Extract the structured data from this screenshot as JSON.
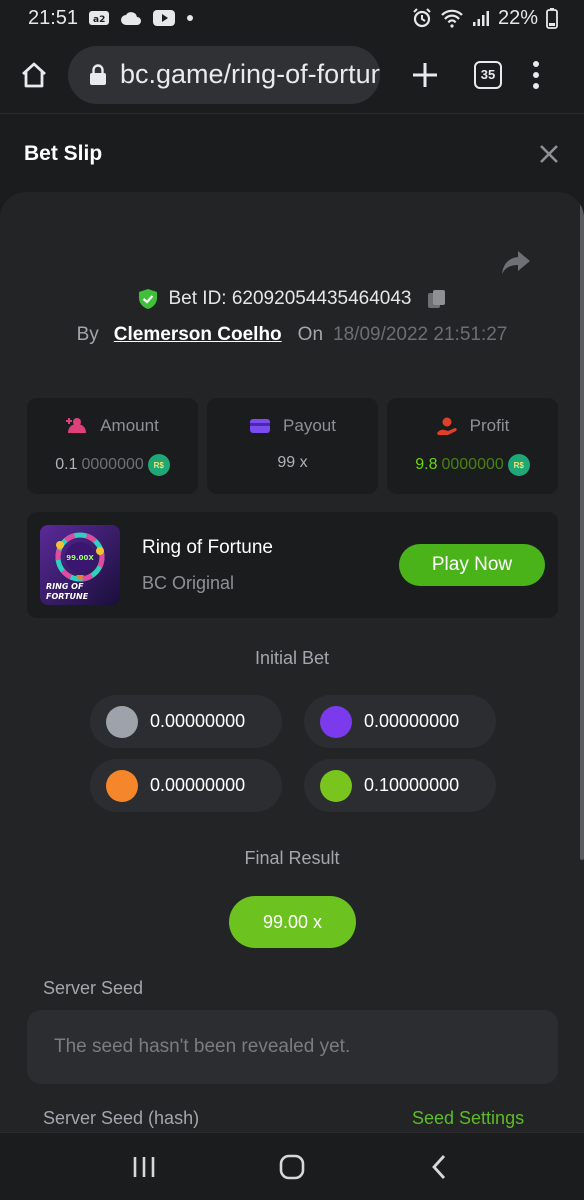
{
  "status_bar": {
    "time": "21:51",
    "battery": "22%"
  },
  "browser": {
    "url": "bc.game/ring-of-fortune",
    "tab_count": "35"
  },
  "modal": {
    "title": "Bet Slip"
  },
  "bet": {
    "id_label": "Bet ID: 62092054435464043",
    "by_label": "By",
    "player": "Clemerson Coelho",
    "on_label": "On",
    "date": "18/09/2022 21:51:27"
  },
  "stats": {
    "amount": {
      "label": "Amount",
      "value_main": "0.1",
      "value_dim": "0000000",
      "currency": "R$"
    },
    "payout": {
      "label": "Payout",
      "value": "99 x"
    },
    "profit": {
      "label": "Profit",
      "value_main": "9.8",
      "value_dim": "0000000",
      "currency": "R$"
    }
  },
  "game": {
    "name": "Ring of Fortune",
    "provider": "BC Original",
    "thumb_multiplier": "99.00X",
    "thumb_title_1": "RING OF",
    "thumb_title_2": "FORTUNE",
    "play_label": "Play Now"
  },
  "initial_bet": {
    "label": "Initial Bet",
    "items": [
      {
        "color": "#9ea3ab",
        "value": "0.00000000"
      },
      {
        "color": "#7c3aed",
        "value": "0.00000000"
      },
      {
        "color": "#f5862a",
        "value": "0.00000000"
      },
      {
        "color": "#7ac41e",
        "value": "0.10000000"
      }
    ]
  },
  "final_result": {
    "label": "Final Result",
    "value": "99.00 x"
  },
  "server_seed": {
    "label": "Server Seed",
    "placeholder": "The seed hasn't been revealed yet.",
    "hash_label": "Server Seed (hash)",
    "settings_label": "Seed Settings"
  },
  "colors": {
    "accent_green": "#4bb31a",
    "result_green": "#6cc21f",
    "panel_bg": "#232426",
    "page_bg": "#1b1c1e"
  }
}
